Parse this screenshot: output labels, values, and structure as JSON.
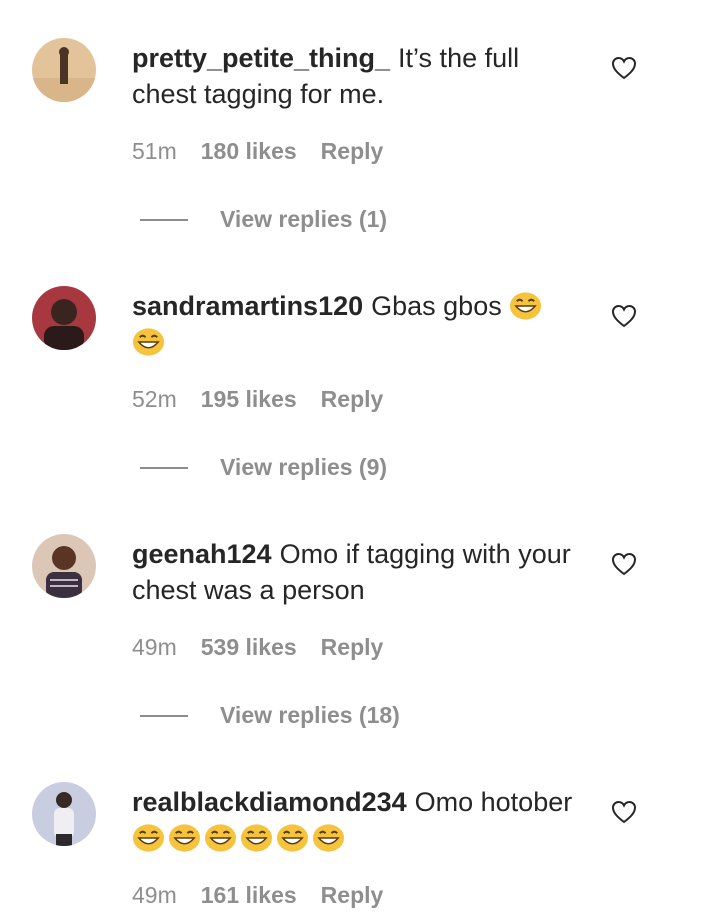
{
  "comments": [
    {
      "username": "pretty_petite_thing_",
      "text": "It’s the full chest tagging for me.",
      "emoji_count": 0,
      "time": "51m",
      "likes": "180 likes",
      "reply": "Reply",
      "view_replies": "View replies (1)",
      "avatar_colors": [
        "#e7c9a0",
        "#5a3f2c"
      ]
    },
    {
      "username": "sandramartins120",
      "text": "Gbas gbos",
      "emoji_count": 2,
      "time": "52m",
      "likes": "195 likes",
      "reply": "Reply",
      "view_replies": "View replies (9)",
      "avatar_colors": [
        "#b0404a",
        "#2a1c1c"
      ]
    },
    {
      "username": "geenah124",
      "text": "Omo if tagging with your chest was a person",
      "emoji_count": 0,
      "time": "49m",
      "likes": "539 likes",
      "reply": "Reply",
      "view_replies": "View replies (18)",
      "avatar_colors": [
        "#d8c1ae",
        "#4b2d22"
      ]
    },
    {
      "username": "realblackdiamond234",
      "text": "Omo hotober",
      "emoji_count": 6,
      "time": "49m",
      "likes": "161 likes",
      "reply": "Reply",
      "view_replies": "",
      "avatar_colors": [
        "#c9cfe0",
        "#2c2a2e"
      ]
    }
  ],
  "icons": {
    "like": "heart-outline-icon",
    "emoji": "grinning-squinting-face"
  },
  "colors": {
    "text": "#262626",
    "secondary": "#8e8e8e",
    "emoji": "#f6c33c"
  }
}
